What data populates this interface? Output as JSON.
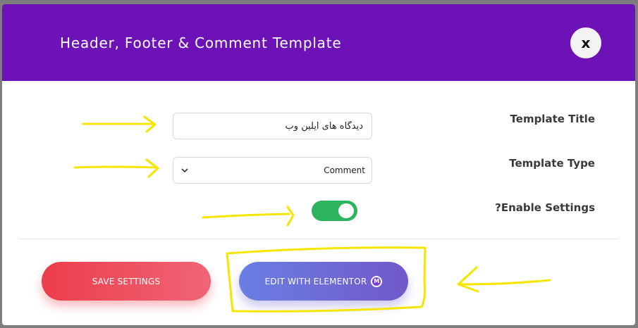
{
  "modal": {
    "title": "Header, Footer & Comment Template",
    "close_label": "x",
    "header_color": "#6c12b6"
  },
  "form": {
    "template_title": {
      "label": "Template Title",
      "value": "دیدگاه های آیلین وب"
    },
    "template_type": {
      "label": "Template Type",
      "selected": "Comment"
    },
    "enable_settings": {
      "label": "?Enable Settings",
      "enabled": true,
      "on_color": "#2db45e"
    }
  },
  "actions": {
    "save_label": "SAVE SETTINGS",
    "edit_label": "EDIT WITH ELEMENTOR",
    "edit_icon": "elementor-icon",
    "edit_icon_glyph": "M"
  },
  "annotations": {
    "color": "#f5e600",
    "marks": [
      "arrow-title",
      "arrow-type",
      "arrow-toggle",
      "highlight-edit-button",
      "arrow-edit-button"
    ]
  }
}
